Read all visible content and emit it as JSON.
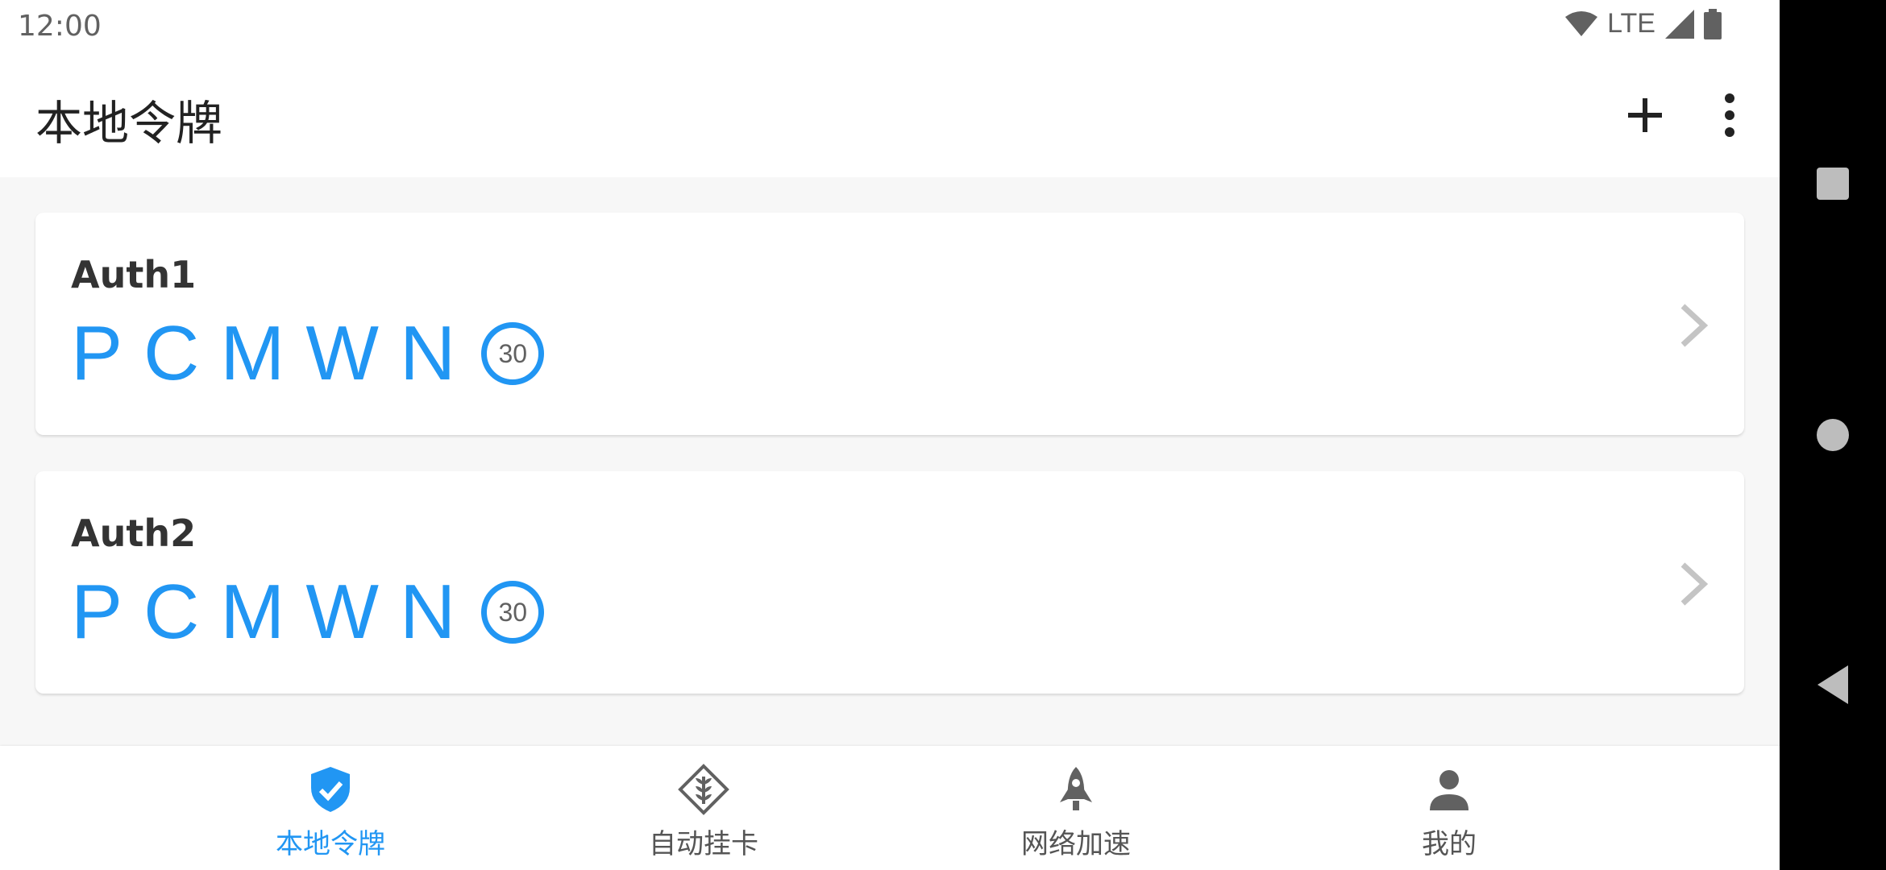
{
  "status_bar": {
    "time": "12:00",
    "network": "LTE"
  },
  "app_bar": {
    "title": "本地令牌",
    "add_icon": "plus-icon",
    "more_icon": "more-vert-icon"
  },
  "tokens": [
    {
      "name": "Auth1",
      "code": "PCMWN",
      "timer": "30"
    },
    {
      "name": "Auth2",
      "code": "PCMWN",
      "timer": "30"
    }
  ],
  "bottom_nav": {
    "items": [
      {
        "label": "本地令牌",
        "icon": "shield-check-icon",
        "active": true
      },
      {
        "label": "自动挂卡",
        "icon": "diamond-wheat-icon",
        "active": false
      },
      {
        "label": "网络加速",
        "icon": "rocket-icon",
        "active": false
      },
      {
        "label": "我的",
        "icon": "person-icon",
        "active": false
      }
    ]
  },
  "colors": {
    "accent": "#2196f3",
    "background": "#f7f7f7",
    "card": "#ffffff"
  }
}
